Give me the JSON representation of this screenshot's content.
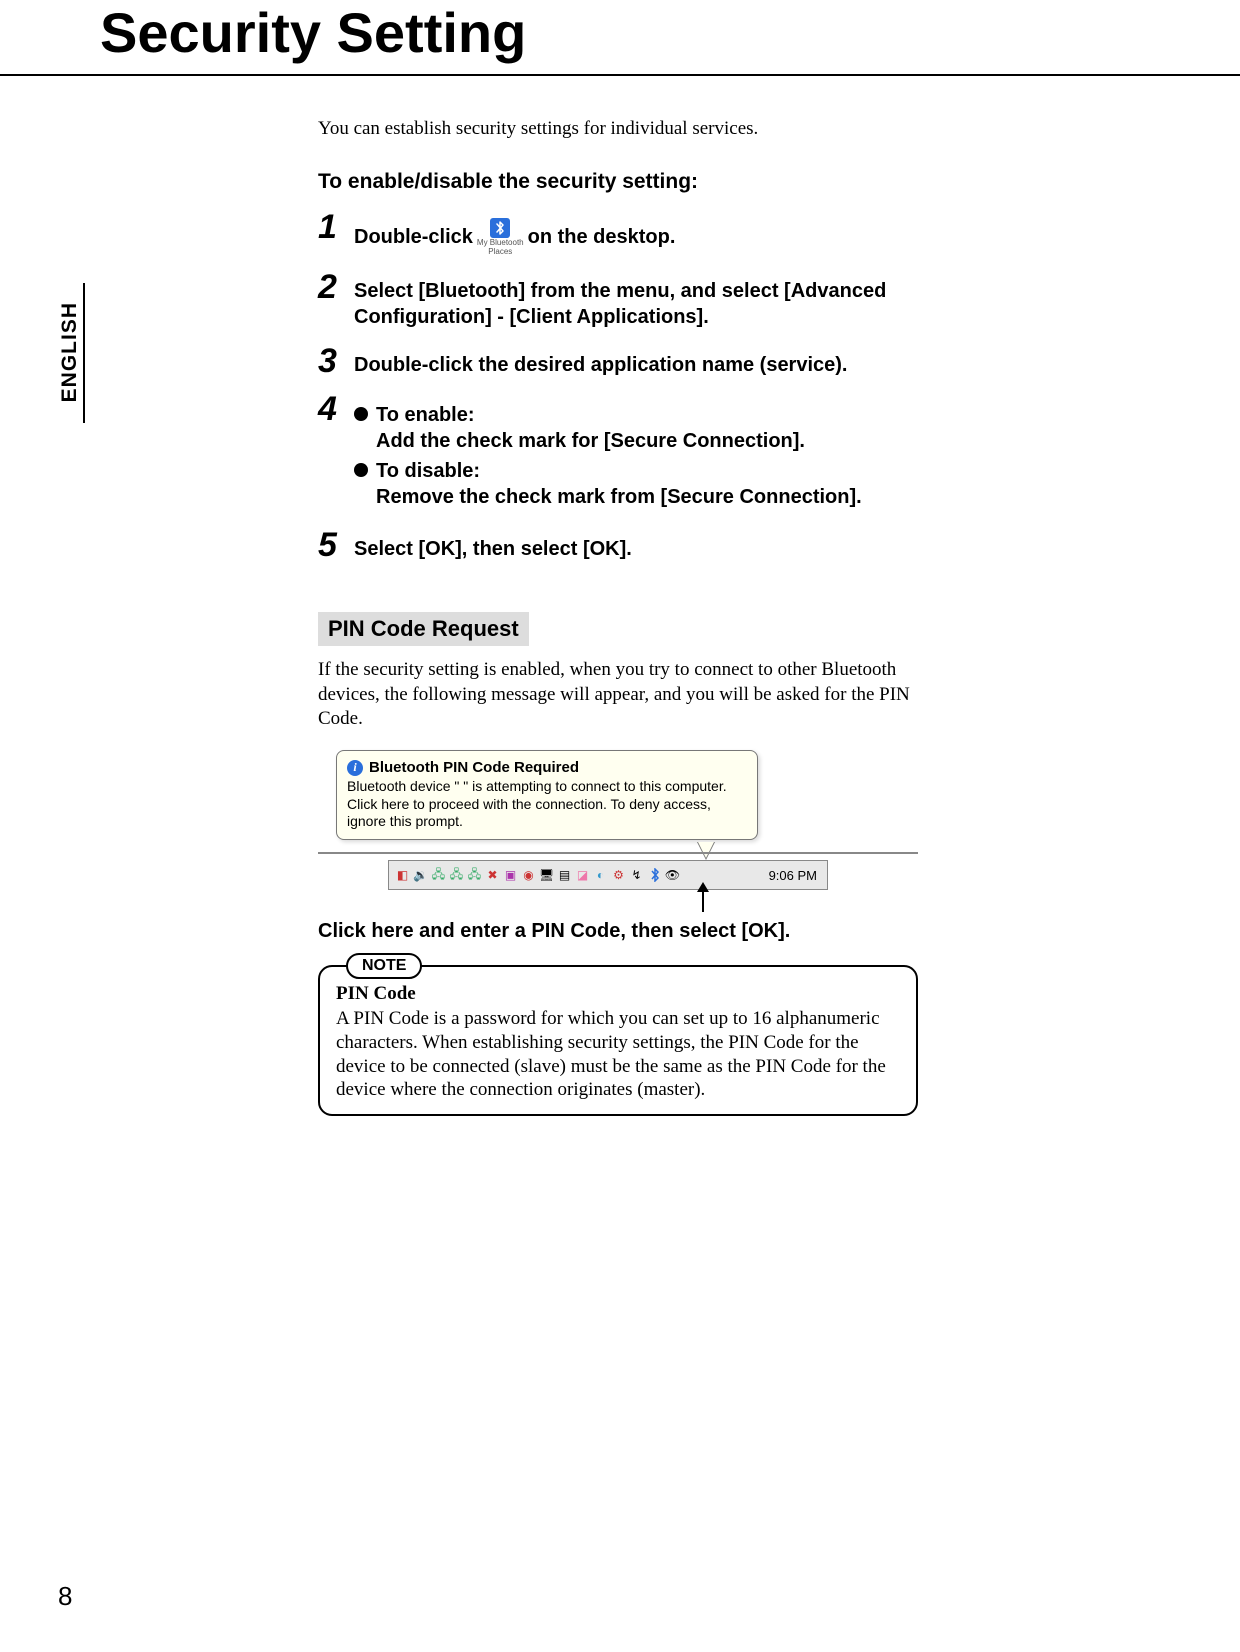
{
  "page": {
    "title": "Security Setting",
    "language_tab": "ENGLISH",
    "number": "8"
  },
  "intro": "You can establish security settings for individual services.",
  "procedure": {
    "heading": "To enable/disable the security setting:",
    "steps": [
      {
        "num": "1",
        "before_icon": "Double-click",
        "icon_caption_top": "My Bluetooth",
        "icon_caption_bottom": "Places",
        "after_icon": "on the desktop."
      },
      {
        "num": "2",
        "text": "Select [Bluetooth] from the menu, and select [Advanced Configuration] - [Client Applications]."
      },
      {
        "num": "3",
        "text": "Double-click the desired application name (service)."
      },
      {
        "num": "4",
        "bullets": [
          {
            "label": "To enable:",
            "sub": "Add the check mark for [Secure Connection]."
          },
          {
            "label": "To disable:",
            "sub": "Remove the check mark from [Secure Connection]."
          }
        ]
      },
      {
        "num": "5",
        "text": "Select [OK], then select [OK]."
      }
    ]
  },
  "pin_section": {
    "heading": "PIN Code Request",
    "body": "If the security setting is enabled, when you try to connect to other Bluetooth devices, the following message will appear, and you will be asked for the PIN Code."
  },
  "balloon": {
    "title": "Bluetooth PIN Code Required",
    "body": "Bluetooth device \"        \" is attempting to connect to this computer.  Click here to proceed with the connection.  To deny access, ignore this prompt."
  },
  "taskbar": {
    "time": "9:06 PM"
  },
  "click_caption": "Click here and enter a PIN Code, then select [OK].",
  "note": {
    "label": "NOTE",
    "heading": "PIN Code",
    "body": "A PIN Code is a password for which you can set up to 16 alphanumeric characters. When establishing security settings, the PIN Code for the device to be connected (slave) must be the same as the PIN Code for the device where the connection originates (master)."
  }
}
